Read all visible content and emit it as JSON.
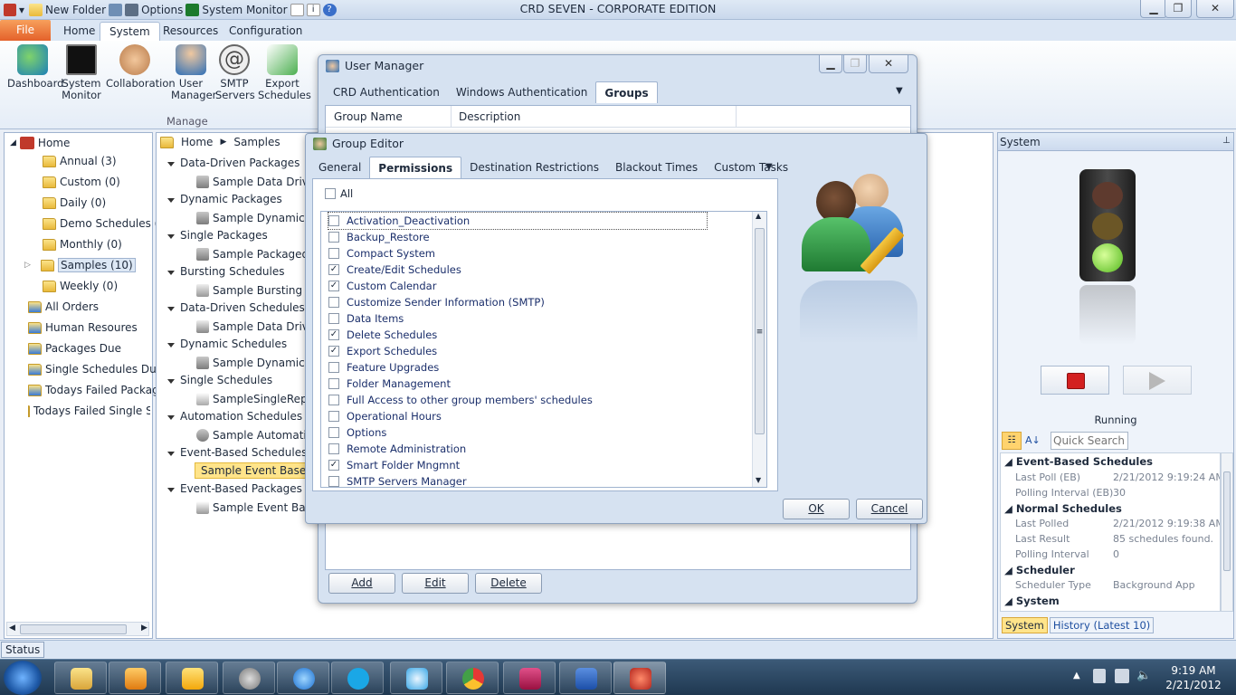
{
  "window": {
    "title": "CRD SEVEN - CORPORATE EDITION"
  },
  "qat": {
    "new_folder": "New Folder",
    "options": "Options",
    "system_monitor": "System Monitor"
  },
  "ribbon": {
    "tabs": [
      "File",
      "Home",
      "System",
      "Resources",
      "Configuration"
    ],
    "buttons": {
      "dashboard": "Dashboard",
      "system_monitor_l1": "System",
      "system_monitor_l2": "Monitor",
      "collaboration": "Collaboration",
      "user_manager_l1": "User",
      "user_manager_l2": "Manager",
      "smtp_l1": "SMTP",
      "smtp_l2": "Servers",
      "export_l1": "Export",
      "export_l2": "Schedules"
    },
    "group_label": "Manage"
  },
  "tree": {
    "home": "Home",
    "folders": [
      "Annual (3)",
      "Custom (0)",
      "Daily (0)",
      "Demo Schedules (0)",
      "Monthly (0)",
      "Samples (10)",
      "Weekly (0)"
    ],
    "smart": [
      "All Orders",
      "Human Resoures",
      "Packages Due",
      "Single Schedules Due",
      "Todays Failed Packages",
      "Todays Failed Single Sc"
    ]
  },
  "breadcrumb": {
    "home": "Home",
    "current": "Samples"
  },
  "list": {
    "groups": [
      {
        "cat": "Data-Driven Packages",
        "item": "Sample Data Driven"
      },
      {
        "cat": "Dynamic Packages",
        "item": "Sample DynamicPac"
      },
      {
        "cat": "Single Packages",
        "item": "Sample Packaged Sc"
      },
      {
        "cat": "Bursting Schedules",
        "item": "Sample Bursting sch"
      },
      {
        "cat": "Data-Driven Schedules",
        "item": "Sample Data Driven"
      },
      {
        "cat": "Dynamic Schedules",
        "item": "Sample Dynamic Sch"
      },
      {
        "cat": "Single Schedules",
        "item": "SampleSingleRepor"
      },
      {
        "cat": "Automation Schedules",
        "item": "Sample Automation"
      },
      {
        "cat": "Event-Based Schedules",
        "item": "Sample Event Basec"
      },
      {
        "cat": "Event-Based Packages",
        "item": "Sample Event Based"
      }
    ]
  },
  "user_manager": {
    "title": "User Manager",
    "tabs": [
      "CRD Authentication",
      "Windows Authentication",
      "Groups"
    ],
    "columns": [
      "Group Name",
      "Description"
    ],
    "add": "Add",
    "edit": "Edit",
    "delete": "Delete"
  },
  "group_editor": {
    "title": "Group Editor",
    "tabs": [
      "General",
      "Permissions",
      "Destination Restrictions",
      "Blackout Times",
      "Custom Tasks"
    ],
    "all_label": "All",
    "permissions": [
      {
        "label": "Activation_Deactivation",
        "checked": false
      },
      {
        "label": "Backup_Restore",
        "checked": false
      },
      {
        "label": "Compact System",
        "checked": false
      },
      {
        "label": "Create/Edit Schedules",
        "checked": true
      },
      {
        "label": "Custom Calendar",
        "checked": true
      },
      {
        "label": "Customize Sender Information (SMTP)",
        "checked": false
      },
      {
        "label": "Data Items",
        "checked": false
      },
      {
        "label": "Delete Schedules",
        "checked": true
      },
      {
        "label": "Export Schedules",
        "checked": true
      },
      {
        "label": "Feature Upgrades",
        "checked": false
      },
      {
        "label": "Folder Management",
        "checked": false
      },
      {
        "label": "Full Access to other group members' schedules",
        "checked": false
      },
      {
        "label": "Operational Hours",
        "checked": false
      },
      {
        "label": "Options",
        "checked": false
      },
      {
        "label": "Remote Administration",
        "checked": false
      },
      {
        "label": "Smart Folder Mngmnt",
        "checked": true
      },
      {
        "label": "SMTP Servers Manager",
        "checked": false
      }
    ],
    "ok": "OK",
    "cancel": "Cancel"
  },
  "system_panel": {
    "title": "System",
    "status": "Running",
    "search_placeholder": "Quick Search",
    "event_based": {
      "header": "Event-Based Schedules",
      "last_poll_k": "Last Poll (EB)",
      "last_poll_v": "2/21/2012 9:19:24 AM",
      "interval_k": "Polling Interval (EB)",
      "interval_v": "30"
    },
    "normal": {
      "header": "Normal Schedules",
      "last_polled_k": "Last Polled",
      "last_polled_v": "2/21/2012 9:19:38 AM",
      "result_k": "Last Result",
      "result_v": "85 schedules found.",
      "interval_k": "Polling Interval",
      "interval_v": "0"
    },
    "scheduler": {
      "header": "Scheduler",
      "type_k": "Scheduler Type",
      "type_v": "Background App"
    },
    "system_header": "System",
    "bottom_tabs": [
      "System",
      "History (Latest 10)"
    ]
  },
  "statusbar": {
    "label": "Status"
  },
  "taskbar": {
    "time": "9:19 AM",
    "date": "2/21/2012"
  },
  "colors": {
    "accent": "#e4612a",
    "selected": "#ffe48a",
    "stop": "#d32020"
  }
}
